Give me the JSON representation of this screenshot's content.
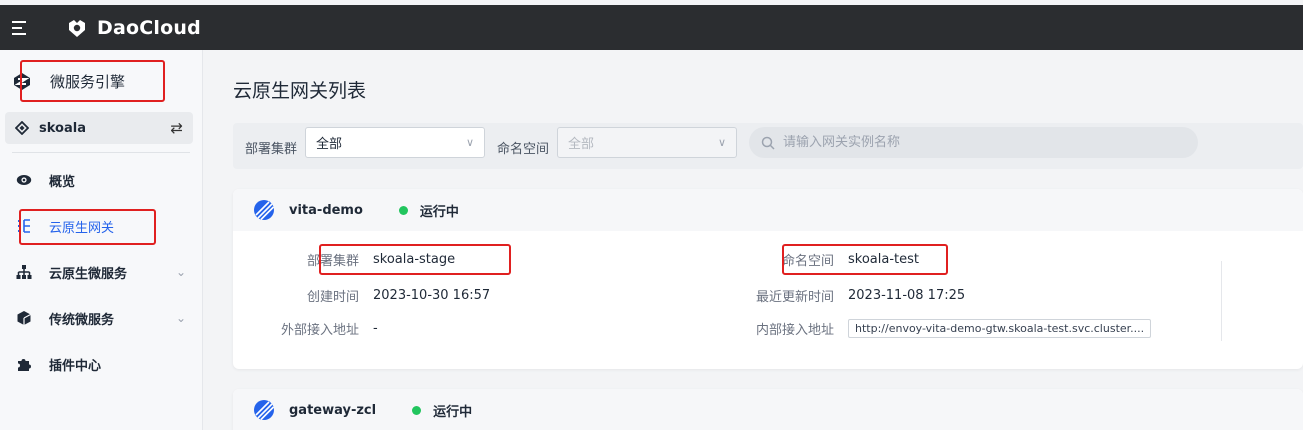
{
  "app": {
    "brand": "DaoCloud"
  },
  "sidebar": {
    "product_name": "微服务引擎",
    "workspace": "skoala",
    "items": [
      {
        "label": "概览",
        "icon": "eye-icon"
      },
      {
        "label": "云原生网关",
        "icon": "gateway-icon",
        "active": true
      },
      {
        "label": "云原生微服务",
        "icon": "hierarchy-icon",
        "expandable": true
      },
      {
        "label": "传统微服务",
        "icon": "cube-icon",
        "expandable": true
      },
      {
        "label": "插件中心",
        "icon": "puzzle-icon"
      }
    ]
  },
  "main": {
    "title": "云原生网关列表",
    "filters": {
      "cluster_label": "部署集群",
      "cluster_value": "全部",
      "namespace_label": "命名空间",
      "namespace_value": "全部",
      "search_placeholder": "请输入网关实例名称"
    },
    "gateways": [
      {
        "name": "vita-demo",
        "status": "运行中",
        "fields": {
          "cluster_label": "部署集群",
          "cluster": "skoala-stage",
          "created_label": "创建时间",
          "created": "2023-10-30 16:57",
          "external_label": "外部接入地址",
          "external": "-",
          "namespace_label": "命名空间",
          "namespace": "skoala-test",
          "updated_label": "最近更新时间",
          "updated": "2023-11-08 17:25",
          "internal_label": "内部接入地址",
          "internal": "http://envoy-vita-demo-gtw.skoala-test.svc.cluster...."
        }
      },
      {
        "name": "gateway-zcl",
        "status": "运行中"
      }
    ]
  },
  "colors": {
    "accent": "#2563eb",
    "running": "#22c55e",
    "highlight": "#e02020",
    "topbar": "#2b2d30"
  }
}
